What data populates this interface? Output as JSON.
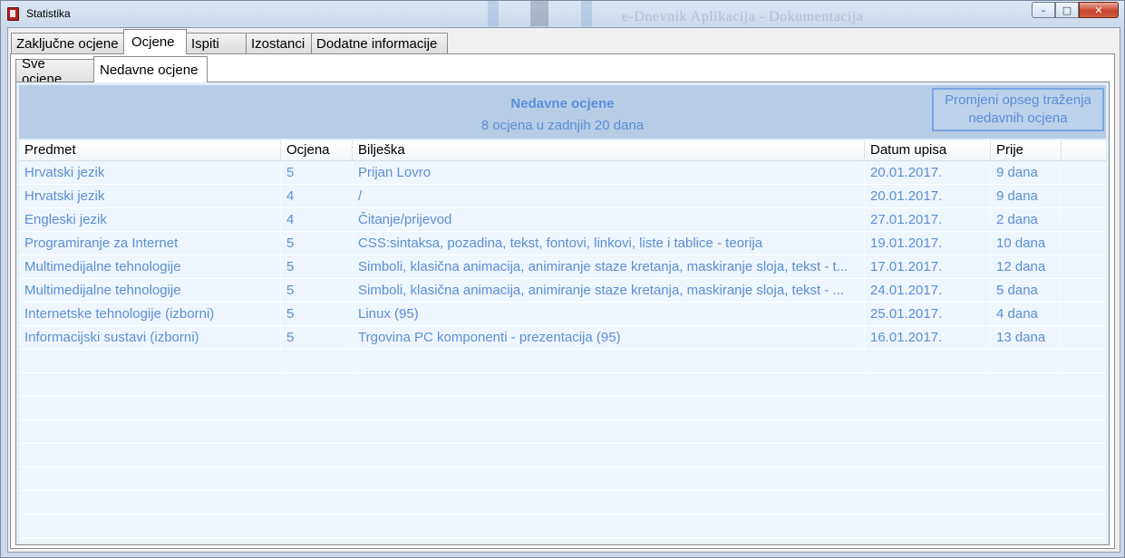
{
  "window": {
    "title": "Statistika",
    "background_title_left": "",
    "background_title_right": "e-Dnevnik Aplikacija - Dokumentacija",
    "buttons": {
      "minimize": "–",
      "maximize": "□",
      "close": "✕"
    }
  },
  "main_tabs": [
    {
      "label": "Zaključne ocjene",
      "active": false
    },
    {
      "label": "Ocjene",
      "active": true
    },
    {
      "label": "Ispiti",
      "active": false
    },
    {
      "label": "Izostanci",
      "active": false
    },
    {
      "label": "Dodatne informacije",
      "active": false
    }
  ],
  "sub_tabs": [
    {
      "label": "Sve ocjene",
      "active": false
    },
    {
      "label": "Nedavne ocjene",
      "active": true
    }
  ],
  "header": {
    "title": "Nedavne ocjene",
    "subtitle": "8 ocjena u zadnjih 20 dana",
    "range_button": "Promjeni opseg traženja nedavnih ocjena"
  },
  "table": {
    "columns": [
      "Predmet",
      "Ocjena",
      "Bilješka",
      "Datum upisa",
      "Prije"
    ],
    "rows": [
      [
        "Hrvatski jezik",
        "5",
        "Prijan Lovro",
        "20.01.2017.",
        "9 dana"
      ],
      [
        "Hrvatski jezik",
        "4",
        "/",
        "20.01.2017.",
        "9 dana"
      ],
      [
        "Engleski jezik",
        "4",
        "Čitanje/prijevod",
        "27.01.2017.",
        "2 dana"
      ],
      [
        "Programiranje za Internet",
        "5",
        "CSS:sintaksa, pozadina, tekst, fontovi, linkovi, liste i tablice - teorija",
        "19.01.2017.",
        "10 dana"
      ],
      [
        "Multimedijalne tehnologije",
        "5",
        "Simboli, klasična animacija, animiranje staze kretanja, maskiranje sloja, tekst - t...",
        "17.01.2017.",
        "12 dana"
      ],
      [
        "Multimedijalne tehnologije",
        "5",
        "Simboli, klasična animacija, animiranje staze kretanja, maskiranje sloja, tekst - ...",
        "24.01.2017.",
        "5 dana"
      ],
      [
        "Internetske tehnologije (izborni)",
        "5",
        "Linux (95)",
        "25.01.2017.",
        "4 dana"
      ],
      [
        "Informacijski sustavi (izborni)",
        "5",
        "Trgovina PC komponenti - prezentacija (95)",
        "16.01.2017.",
        "13 dana"
      ]
    ]
  },
  "colors": {
    "accent_text": "#5b8fd3",
    "header_band": "#b7cde6",
    "grid_background": "#eef5fc"
  }
}
